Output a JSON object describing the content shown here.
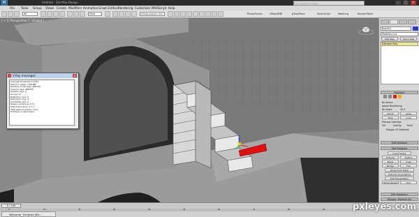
{
  "window": {
    "title": "Untitled - 3ds Max Design",
    "app_logo": "M",
    "help_search_placeholder": "Type a keyword or phrase",
    "controls": [
      "–",
      "□",
      "✕"
    ]
  },
  "menubar": [
    "File",
    "Tools",
    "Group",
    "Views",
    "Create",
    "Modifiers",
    "Animation",
    "Graph Editors",
    "Rendering",
    "Customize",
    "MAXScript",
    "Help"
  ],
  "toolbar": {
    "selection_filter": "All",
    "coordinate_system": "View",
    "selection_set": "Create Selection Set",
    "labels": [
      "PhotoStudio",
      "VRayHDRI",
      "gTreePlant",
      "SketchUp2",
      "Meshing",
      "RenderMesh"
    ]
  },
  "viewport": {
    "label": "[ + ] [ Perspective ] [ Shaded ]"
  },
  "vray_dialog": {
    "title": "V-Ray messages",
    "lines": [
      "Average faces/leaf: 0.7023",
      "Memory usage: 1.66 MB",
      "Number of raycasts: 968796",
      "Camera rays: 968796",
      "Shadow rays: 0",
      "GI rays: 0",
      "Reflection rays: 0",
      "Refraction rays: 0",
      "Unshaded rays: 0",
      "Region rendering: 2.7 s",
      "Total frame time: 2.7 s",
      "Total sequence time: 2.8 s",
      "Frame(s): 0 warning(s)"
    ]
  },
  "command_panel": {
    "object_name": "Box001",
    "modifier_list": "Modifier List",
    "stack_item": "Editable Poly",
    "buttons_top": [
      "Edit Tags",
      "Quick Tags"
    ],
    "rollouts": {
      "selection": "Selection",
      "soft_selection": "Soft Selection",
      "edit_polygons": "Edit Polygons",
      "edit_geometry": "Edit Geometry",
      "polygon_material": "Polygon: Material IDs"
    },
    "selection_options": {
      "by_vertex": "By Vertex",
      "ignore_backfacing": "Ignore Backfacing",
      "by_angle": "By Angle:",
      "angle_value": "45.0",
      "shrink": "Shrink",
      "grow": "Grow",
      "ring": "Ring",
      "loop": "Loop",
      "preview_selection": "Preview Selection",
      "preview_off": "Off",
      "preview_subobj": "SubObj",
      "preview_multi": "Multi",
      "status": "Polygon 25 Selected"
    },
    "edit_poly_buttons": [
      "Insert Vertex",
      "Extrude",
      "Outline",
      "Bevel",
      "Inset",
      "Bridge",
      "Flip",
      "Hinge From Edge",
      "Extrude Along Spline",
      "Edit Triangulation",
      "Retriangulate",
      "Turn"
    ]
  },
  "timeline": {
    "slider": "0 / 100",
    "ticks": [
      "0",
      "10",
      "20",
      "30",
      "40",
      "50",
      "60",
      "70",
      "80",
      "90",
      "100"
    ]
  },
  "statusbar": {
    "taskbar_item": "Welcome, Scripted Wiz..."
  },
  "watermark": "pxleyes.com",
  "colors": {
    "viewport_bg": "#7d7d7d",
    "selection_red": "#e01010",
    "stack_yellow": "#f0e68c",
    "object_color": "#2b3cc7"
  }
}
